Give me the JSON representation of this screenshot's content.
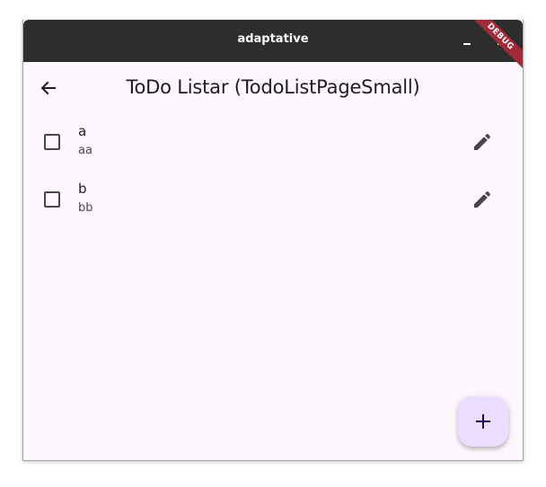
{
  "window": {
    "title": "adaptative"
  },
  "appbar": {
    "title": "ToDo Listar (TodoListPageSmall)",
    "back_icon": "arrow-back-icon"
  },
  "debug_banner": "DEBUG",
  "todos": [
    {
      "title": "a",
      "subtitle": "aa",
      "checked": false
    },
    {
      "title": "b",
      "subtitle": "bb",
      "checked": false
    }
  ],
  "icons": {
    "minimize": "minimize-icon",
    "close": "close-icon",
    "edit": "pencil-icon",
    "add": "plus-icon"
  },
  "colors": {
    "titlebar": "#2e2e2e",
    "background": "#fef7fe",
    "fab": "#eaddff",
    "debug_banner": "#a32a38"
  }
}
